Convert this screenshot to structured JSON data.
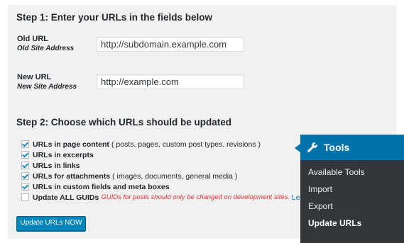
{
  "step1": {
    "title": "Step 1: Enter your URLs in the fields below",
    "old_label": "Old URL",
    "old_sublabel": "Old Site Address",
    "old_value": "http://subdomain.example.com",
    "new_label": "New URL",
    "new_sublabel": "New Site Address",
    "new_value": "http://example.com"
  },
  "step2": {
    "title": "Step 2: Choose which URLs should be updated",
    "options": [
      {
        "label": "URLs in page content",
        "desc": "( posts, pages, custom post types, revisions )",
        "checked": true
      },
      {
        "label": "URLs in excerpts",
        "desc": "",
        "checked": true
      },
      {
        "label": "URLs in links",
        "desc": "",
        "checked": true
      },
      {
        "label": "URLs for attachments",
        "desc": "( images, documents, general media )",
        "checked": true
      },
      {
        "label": "URLs in custom fields and meta boxes",
        "desc": "",
        "checked": true
      },
      {
        "label": "Update ALL GUIDs",
        "warning": "GUIDs for posts should only be changed on development sites.",
        "link": "Le",
        "checked": false
      }
    ]
  },
  "button": {
    "label": "Update URLs NOW"
  },
  "menu": {
    "title": "Tools",
    "icon": "wrench-icon",
    "items": [
      "Available Tools",
      "Import",
      "Export",
      "Update URLs"
    ],
    "current": "Update URLs"
  },
  "colors": {
    "accent": "#0073aa",
    "button": "#0085ba",
    "warning": "#dc3232",
    "menu_bg": "#32373c"
  }
}
